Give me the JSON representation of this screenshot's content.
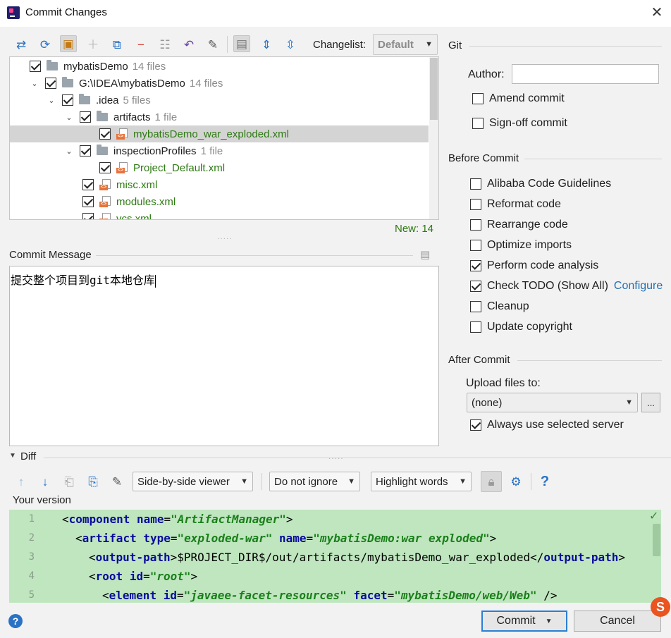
{
  "window": {
    "title": "Commit Changes"
  },
  "toolbar": {
    "changelist_label": "Changelist:",
    "changelist_value": "Default",
    "icons": [
      "pin-icon",
      "refresh-icon",
      "shelve-icon",
      "add-icon",
      "jump-to-source-icon",
      "remove-icon",
      "group-icon",
      "revert-icon",
      "edit-icon",
      "diff-toggle-icon",
      "expand-all-icon",
      "collapse-all-icon"
    ]
  },
  "tree": {
    "rows": [
      {
        "name": "mybatisDemo",
        "count": "14 files",
        "kind": "folder"
      },
      {
        "name": "G:\\IDEA\\mybatisDemo",
        "count": "14 files",
        "kind": "folder"
      },
      {
        "name": ".idea",
        "count": "5 files",
        "kind": "folder"
      },
      {
        "name": "artifacts",
        "count": "1 file",
        "kind": "folder"
      },
      {
        "name": "mybatisDemo_war_exploded.xml",
        "count": "",
        "kind": "xml"
      },
      {
        "name": "inspectionProfiles",
        "count": "1 file",
        "kind": "folder"
      },
      {
        "name": "Project_Default.xml",
        "count": "",
        "kind": "xml"
      },
      {
        "name": "misc.xml",
        "count": "",
        "kind": "xml"
      },
      {
        "name": "modules.xml",
        "count": "",
        "kind": "xml"
      },
      {
        "name": "vcs.xml",
        "count": "",
        "kind": "xml"
      }
    ],
    "new_count": "New: 14"
  },
  "commit_message": {
    "label": "Commit Message",
    "text": "提交整个项目到git本地仓库"
  },
  "git": {
    "section_title": "Git",
    "author_label": "Author:",
    "author_value": "",
    "amend_label": "Amend commit",
    "signoff_label": "Sign-off commit"
  },
  "before_commit": {
    "title": "Before Commit",
    "options": [
      {
        "label": "Alibaba Code Guidelines",
        "checked": false
      },
      {
        "label": "Reformat code",
        "checked": false
      },
      {
        "label": "Rearrange code",
        "checked": false
      },
      {
        "label": "Optimize imports",
        "checked": false
      },
      {
        "label": "Perform code analysis",
        "checked": true
      },
      {
        "label": "Check TODO (Show All)",
        "checked": true
      },
      {
        "label": "Cleanup",
        "checked": false
      },
      {
        "label": "Update copyright",
        "checked": false
      }
    ],
    "configure_link": "Configure"
  },
  "after_commit": {
    "title": "After Commit",
    "upload_label": "Upload files to:",
    "upload_value": "(none)",
    "browse_label": "...",
    "always_label": "Always use selected server"
  },
  "diff": {
    "title": "Diff",
    "viewer": "Side-by-side viewer",
    "ignore": "Do not ignore",
    "highlight": "Highlight words",
    "help": "?",
    "your_version": "Your version",
    "lines": [
      {
        "n": "1",
        "indent": 0,
        "tag": "component",
        "attrs": [
          {
            "k": "name",
            "v": "\"ArtifactManager\""
          }
        ],
        "after": ">"
      },
      {
        "n": "2",
        "indent": 1,
        "tag": "artifact",
        "attrs": [
          {
            "k": "type",
            "v": "\"exploded-war\""
          },
          {
            "k": "name",
            "v": "\"mybatisDemo:war exploded\""
          }
        ],
        "after": ">"
      },
      {
        "n": "3",
        "indent": 2,
        "tag": "output-path",
        "text": "$PROJECT_DIR$/out/artifacts/mybatisDemo_war_exploded",
        "close": "output-path"
      },
      {
        "n": "4",
        "indent": 2,
        "tag": "root",
        "attrs": [
          {
            "k": "id",
            "v": "\"root\""
          }
        ],
        "after": ">"
      },
      {
        "n": "5",
        "indent": 3,
        "tag": "element",
        "attrs": [
          {
            "k": "id",
            "v": "\"javaee-facet-resources\""
          },
          {
            "k": "facet",
            "v": "\"mybatisDemo/web/Web\""
          }
        ],
        "after": " />"
      }
    ]
  },
  "footer": {
    "help": "?",
    "commit_label": "Commit",
    "cancel_label": "Cancel"
  },
  "colors": {
    "added_bg": "#bfe6bf",
    "new_file_text": "#2d7a12",
    "link": "#2470b3",
    "primary_border": "#2a7fd4"
  }
}
